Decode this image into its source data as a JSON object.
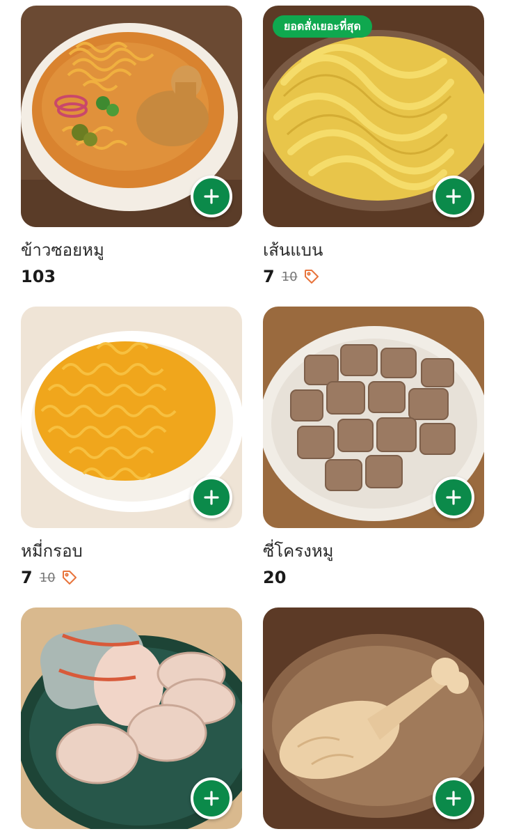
{
  "items": [
    {
      "name": "ข้าวซอยหมู",
      "price": "103",
      "original_price": "",
      "badge": "",
      "image": "khao-soi-bowl-image"
    },
    {
      "name": "เส้นแบน",
      "price": "7",
      "original_price": "10",
      "badge": "ยอดสั่งเยอะที่สุด",
      "image": "flat-noodles-image"
    },
    {
      "name": "หมี่กรอบ",
      "price": "7",
      "original_price": "10",
      "badge": "",
      "image": "crispy-noodles-image"
    },
    {
      "name": "ซี่โครงหมู",
      "price": "20",
      "original_price": "",
      "badge": "",
      "image": "pork-ribs-image"
    },
    {
      "name": "",
      "price": "",
      "original_price": "",
      "badge": "",
      "image": "pork-sausage-image"
    },
    {
      "name": "",
      "price": "",
      "original_price": "",
      "badge": "",
      "image": "chicken-drumstick-image"
    }
  ],
  "colors": {
    "accent": "#0b8a4a",
    "badge": "#0fa84f",
    "discount_tag": "#e8743b"
  }
}
